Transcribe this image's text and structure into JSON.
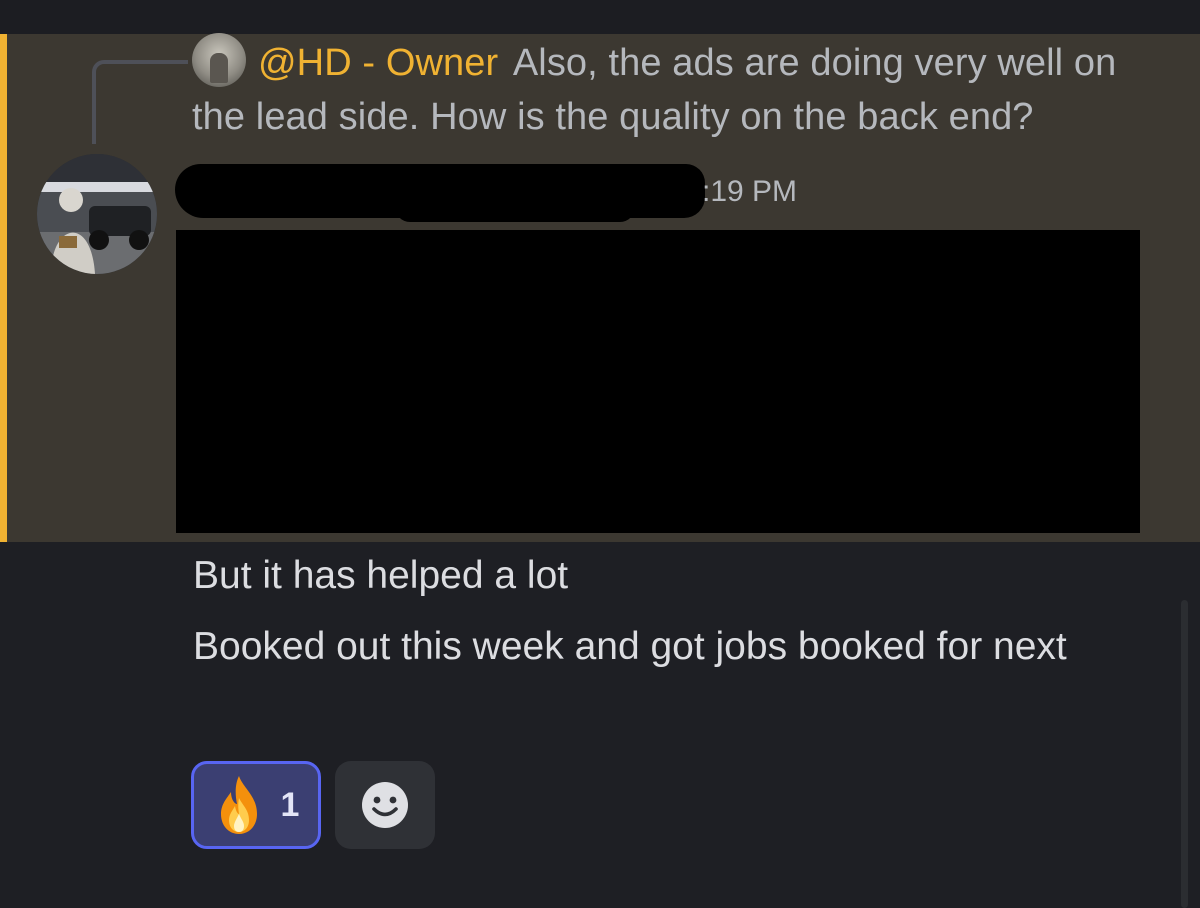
{
  "reply": {
    "author": "@HD - Owner",
    "text": "Also, the ads are doing very well on the lead side. How is the quality on the back end?"
  },
  "message": {
    "timestamp": ":19 PM",
    "lines": [
      "But it has helped a lot",
      "Booked out this week and got jobs booked for next"
    ]
  },
  "reactions": [
    {
      "emoji": "fire-emoji",
      "count": "1",
      "active": true
    }
  ],
  "icons": {
    "add_reaction": "smiley-face-icon"
  },
  "colors": {
    "mention_highlight": "#3c3831",
    "mention_bar": "#f0b232",
    "author_name": "#f0b232",
    "reaction_border": "#5865f2",
    "reaction_bg": "#3b3f72"
  }
}
